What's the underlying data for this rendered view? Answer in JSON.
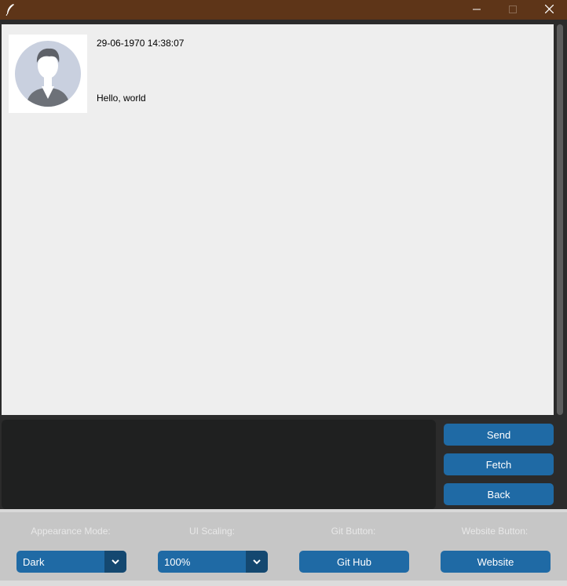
{
  "window": {
    "controls": {
      "minimize_icon": "minimize-icon",
      "maximize_icon": "maximize-icon",
      "close_icon": "close-icon"
    },
    "app_icon": "feather-icon"
  },
  "chat": {
    "messages": [
      {
        "timestamp": "29-06-1970 14:38:07",
        "text": "Hello, world",
        "avatar_icon": "user-avatar-icon"
      }
    ]
  },
  "composer": {
    "value": "",
    "send_label": "Send",
    "fetch_label": "Fetch",
    "back_label": "Back"
  },
  "settings": {
    "appearance_label": "Appearance Mode:",
    "appearance_value": "Dark",
    "scaling_label": "UI Scaling:",
    "scaling_value": "100%",
    "git_label": "Git Button:",
    "git_button": "Git Hub",
    "website_label": "Website Button:",
    "website_button": "Website"
  },
  "colors": {
    "titlebar": "#5e3518",
    "accent": "#1f6aa5",
    "accent_dark": "#144870",
    "chat_bg": "#eeeeee",
    "input_bg": "#1f2020",
    "panel_bg": "#c6c6c6"
  }
}
